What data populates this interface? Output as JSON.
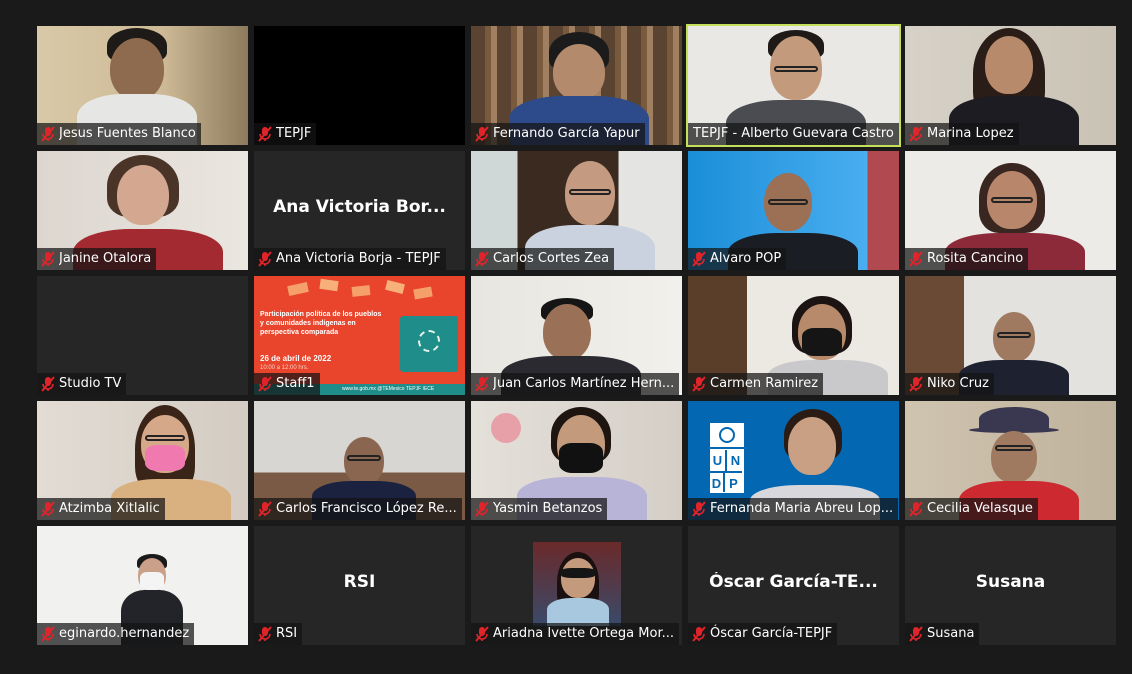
{
  "meeting": {
    "participants": [
      {
        "name": "Jesus Fuentes Blanco",
        "muted": true
      },
      {
        "name": "TEPJF",
        "muted": true
      },
      {
        "name": "Fernando García Yapur",
        "muted": true
      },
      {
        "name": "TEPJF - Alberto Guevara Castro",
        "muted": false,
        "active_speaker": true
      },
      {
        "name": "Marina Lopez",
        "muted": true
      },
      {
        "name": "Janine Otalora",
        "muted": true
      },
      {
        "name": "Ana Victoria Borja - TEPJF",
        "display": "Ana Victoria Bor...",
        "muted": true
      },
      {
        "name": "Carlos Cortes Zea",
        "muted": true
      },
      {
        "name": "Alvaro POP",
        "muted": true
      },
      {
        "name": "Rosita Cancino",
        "muted": true
      },
      {
        "name": "Studio TV",
        "muted": true
      },
      {
        "name": "Staff1",
        "muted": true
      },
      {
        "name": "Juan Carlos Martínez Hern...",
        "muted": true
      },
      {
        "name": "Carmen Ramirez",
        "muted": true
      },
      {
        "name": "Niko Cruz",
        "muted": true
      },
      {
        "name": "Atzimba Xitlalic",
        "muted": true
      },
      {
        "name": "Carlos Francisco López Re...",
        "muted": true
      },
      {
        "name": "Yasmin Betanzos",
        "muted": true
      },
      {
        "name": "Fernanda Maria Abreu Lop...",
        "muted": true
      },
      {
        "name": "Cecilia Velasque",
        "muted": true
      },
      {
        "name": "eginardo.hernandez",
        "muted": true
      },
      {
        "name": "RSI",
        "display": "RSI",
        "muted": true
      },
      {
        "name": "Ariadna Ivette Ortega Mor...",
        "muted": true
      },
      {
        "name": "Óscar García-TEPJF",
        "display": "Óscar García-TE...",
        "muted": true
      },
      {
        "name": "Susana",
        "display": "Susana",
        "muted": true
      }
    ]
  },
  "slide": {
    "title_lines": [
      "Participación política de los pueblos",
      "y comunidades indígenas en",
      "perspectiva comparada"
    ],
    "date": "26 de abril de 2022",
    "time": "10:00 a 12:00 hrs.",
    "footer": "www.te.gob.mx   @TEMexico   TEPJF   IECE"
  },
  "undp_logo": [
    "U",
    "N",
    "D",
    "P"
  ],
  "colors": {
    "active_border": "#c4e05a",
    "muted_icon": "#e0242a",
    "slide_bg": "#e8452c",
    "undp_blue": "#0467b1"
  },
  "icons": {
    "mic": "mic-muted-icon"
  }
}
